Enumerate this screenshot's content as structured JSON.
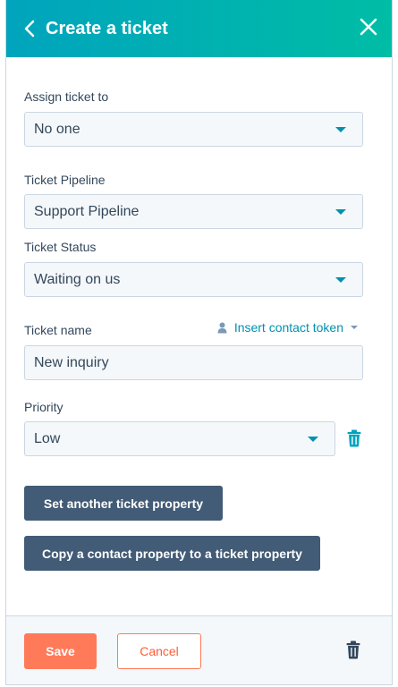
{
  "header": {
    "title": "Create a ticket"
  },
  "assign": {
    "label": "Assign ticket to",
    "value": "No one"
  },
  "pipeline": {
    "label": "Ticket Pipeline",
    "value": "Support Pipeline"
  },
  "status": {
    "label": "Ticket Status",
    "value": "Waiting on us"
  },
  "ticket_name": {
    "label": "Ticket name",
    "value": "New inquiry",
    "token_link": "Insert contact token"
  },
  "priority": {
    "label": "Priority",
    "value": "Low"
  },
  "actions": {
    "set_property": "Set another ticket property",
    "copy_property": "Copy a contact property to a ticket property"
  },
  "footer": {
    "save": "Save",
    "cancel": "Cancel"
  },
  "colors": {
    "header_start": "#00a4bd",
    "header_end": "#00bda5",
    "accent": "#0091ae",
    "save": "#ff7a59",
    "dark_button": "#425b76"
  },
  "icons": {
    "back": "chevron-left-icon",
    "close": "close-icon",
    "caret": "caret-down-icon",
    "person": "person-icon",
    "trash": "trash-icon"
  }
}
